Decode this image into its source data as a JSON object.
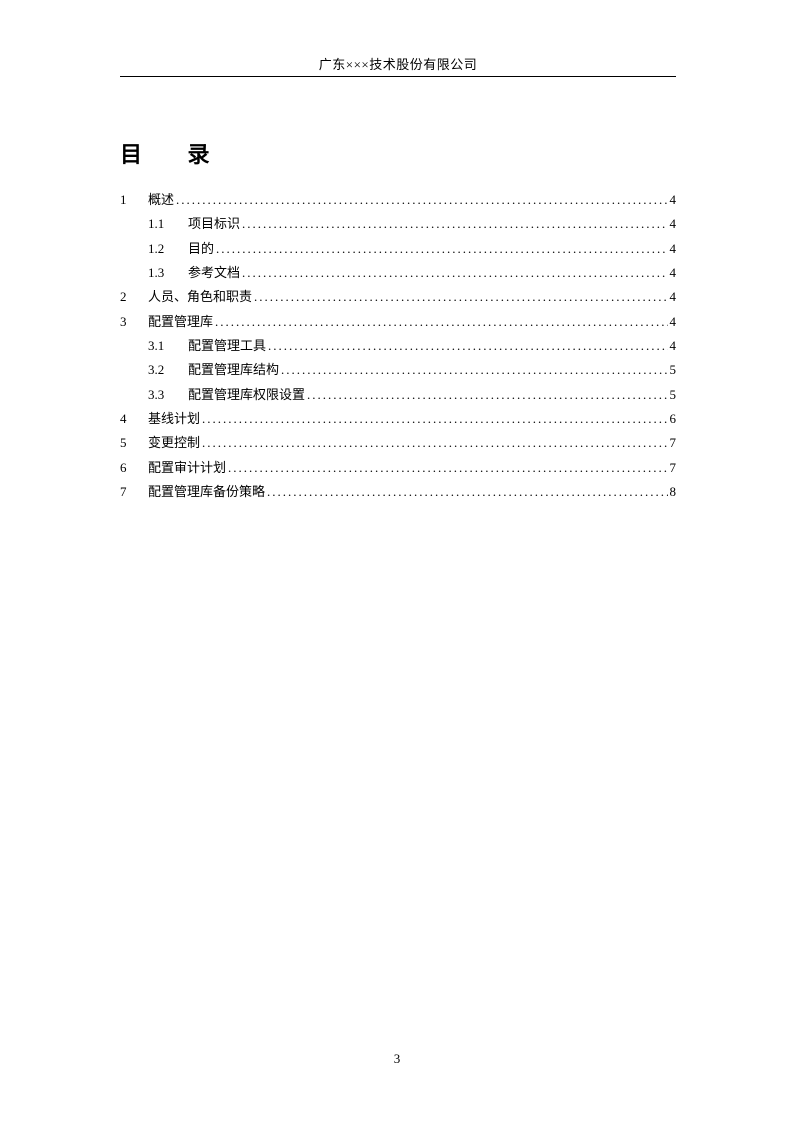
{
  "header": {
    "company": "广东×××技术股份有限公司"
  },
  "title": "目 录",
  "toc": [
    {
      "level": 1,
      "num": "1",
      "label": "概述",
      "page": "4"
    },
    {
      "level": 2,
      "num": "1.1",
      "label": "项目标识",
      "page": "4"
    },
    {
      "level": 2,
      "num": "1.2",
      "label": "目的",
      "page": "4"
    },
    {
      "level": 2,
      "num": "1.3",
      "label": "参考文档",
      "page": "4"
    },
    {
      "level": 1,
      "num": "2",
      "label": "人员、角色和职责",
      "page": "4"
    },
    {
      "level": 1,
      "num": "3",
      "label": "配置管理库",
      "page": "4"
    },
    {
      "level": 2,
      "num": "3.1",
      "label": "配置管理工具",
      "page": "4"
    },
    {
      "level": 2,
      "num": "3.2",
      "label": "配置管理库结构",
      "page": "5"
    },
    {
      "level": 2,
      "num": "3.3",
      "label": "配置管理库权限设置",
      "page": "5"
    },
    {
      "level": 1,
      "num": "4",
      "label": "基线计划",
      "page": "6"
    },
    {
      "level": 1,
      "num": "5",
      "label": "变更控制",
      "page": "7"
    },
    {
      "level": 1,
      "num": "6",
      "label": "配置审计计划",
      "page": "7"
    },
    {
      "level": 1,
      "num": "7",
      "label": "配置管理库备份策略",
      "page": "8"
    }
  ],
  "page_number": "3"
}
